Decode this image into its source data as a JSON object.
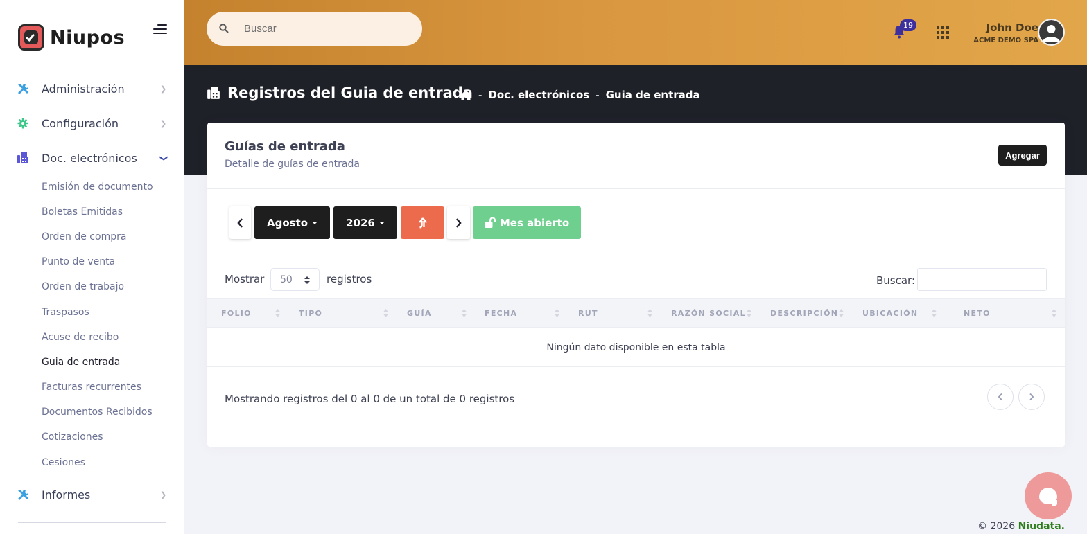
{
  "app": {
    "brand": "Niupos"
  },
  "sidebar": {
    "items": [
      {
        "label": "Administración",
        "icon": "tools-icon"
      },
      {
        "label": "Configuración",
        "icon": "gear-icon"
      },
      {
        "label": "Doc. electrónicos",
        "icon": "fax-icon",
        "expanded": true
      },
      {
        "label": "Informes",
        "icon": "tools-icon"
      }
    ],
    "sub_items": [
      "Emisión de documento",
      "Boletas Emitidas",
      "Orden de compra",
      "Punto de venta",
      "Orden de trabajo",
      "Traspasos",
      "Acuse de recibo",
      "Guia de entrada",
      "Facturas recurrentes",
      "Documentos Recibidos",
      "Cotizaciones",
      "Cesiones"
    ],
    "active_sub_item": "Guia de entrada"
  },
  "header": {
    "search_placeholder": "Buscar",
    "notifications_count": "19",
    "user_name": "John Doe",
    "user_company": "ACME DEMO SPA"
  },
  "page": {
    "title": "Registros del Guia de entrada",
    "breadcrumb": [
      "Doc. electrónicos",
      "Guia de entrada"
    ],
    "separator": "-"
  },
  "card": {
    "title": "Guías de entrada",
    "subtitle": "Detalle de guías de entrada",
    "add_button": "Agregar"
  },
  "filters": {
    "month": "Agosto",
    "year": "2026",
    "status_button": "Mes abierto"
  },
  "table": {
    "show_label": "Mostrar",
    "page_length": "50",
    "records_label": "registros",
    "search_label": "Buscar:",
    "columns": [
      "FOLIO",
      "TIPO",
      "GUÍA",
      "FECHA",
      "RUT",
      "RAZÓN SOCIAL",
      "DESCRIPCIÓN",
      "UBICACIÓN",
      "NETO"
    ],
    "empty_message": "Ningún dato disponible en esta tabla",
    "info": "Mostrando registros del 0 al 0 de un total de 0 registros"
  },
  "footer": {
    "copyright": "© 2026",
    "company": "Niudata."
  },
  "colors": {
    "header_gradient_start": "#c5822e",
    "header_gradient_end": "#e2a64a",
    "band": "#1f2129",
    "accent_blue": "#3949ab",
    "export_button": "#ec6b4d",
    "status_button": "#6fcf8f",
    "chat_button": "#ee9a9a",
    "badge": "#3d2f9c"
  }
}
